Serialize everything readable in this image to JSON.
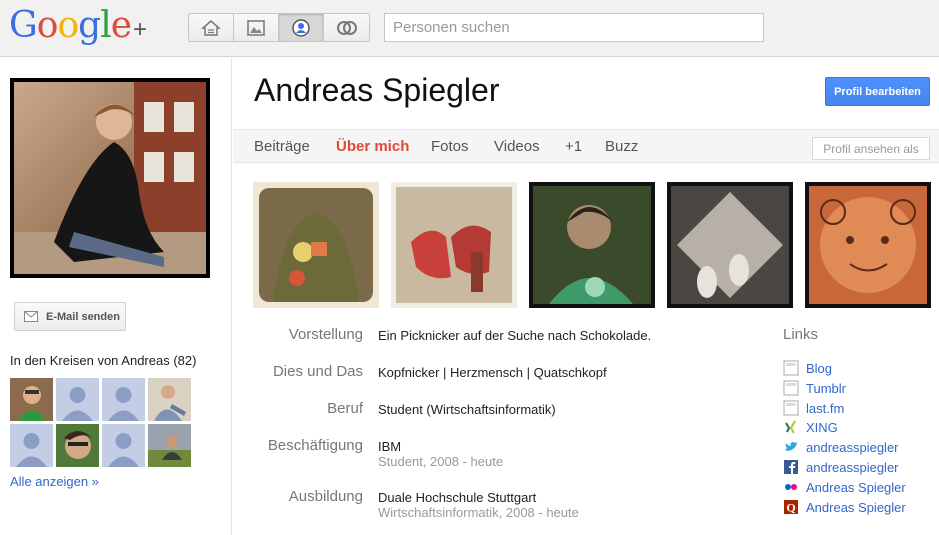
{
  "header": {
    "logo_text": "Google",
    "logo_plus": "+",
    "logo_colors": [
      "#3b6ee0",
      "#dd4b39",
      "#f4b400",
      "#3b6ee0",
      "#2d9f47",
      "#dd4b39"
    ],
    "nav_icons": [
      "home-icon",
      "photos-icon",
      "profile-icon",
      "circles-icon"
    ],
    "active_nav": "profile-icon",
    "search_placeholder": "Personen suchen"
  },
  "sidebar": {
    "email_button": "E-Mail senden",
    "circles_title": "In den Kreisen von Andreas (82)",
    "show_all": "Alle anzeigen »"
  },
  "profile": {
    "name": "Andreas Spiegler",
    "edit_button": "Profil bearbeiten",
    "view_as": "Profil ansehen als",
    "tabs": [
      "Beiträge",
      "Über mich",
      "Fotos",
      "Videos",
      "+1",
      "Buzz"
    ],
    "active_tab": "Über mich",
    "about": [
      {
        "label": "Vorstellung",
        "value": "Ein Picknicker auf der Suche nach Schokolade.",
        "sub": ""
      },
      {
        "label": "Dies und Das",
        "value": "Kopfnicker | Herzmensch | Quatschkopf",
        "sub": ""
      },
      {
        "label": "Beruf",
        "value": "Student (Wirtschaftsinformatik)",
        "sub": ""
      },
      {
        "label": "Beschäftigung",
        "value": "IBM",
        "sub": "Student, 2008 - heute"
      },
      {
        "label": "Ausbildung",
        "value": "Duale Hochschule Stuttgart",
        "sub": "Wirtschaftsinformatik, 2008 - heute"
      }
    ]
  },
  "links": {
    "title": "Links",
    "items": [
      {
        "label": "Blog",
        "icon": "page-icon"
      },
      {
        "label": "Tumblr",
        "icon": "page-icon"
      },
      {
        "label": "last.fm",
        "icon": "page-icon"
      },
      {
        "label": "XING",
        "icon": "xing-icon"
      },
      {
        "label": "andreasspiegler",
        "icon": "twitter-icon"
      },
      {
        "label": "andreasspiegler",
        "icon": "facebook-icon"
      },
      {
        "label": "Andreas Spiegler",
        "icon": "flickr-icon"
      },
      {
        "label": "Andreas Spiegler",
        "icon": "quora-icon"
      }
    ]
  },
  "colors": {
    "accent_blue": "#4d90fe",
    "active_tab": "#dd4b39",
    "link": "#3366cc"
  }
}
